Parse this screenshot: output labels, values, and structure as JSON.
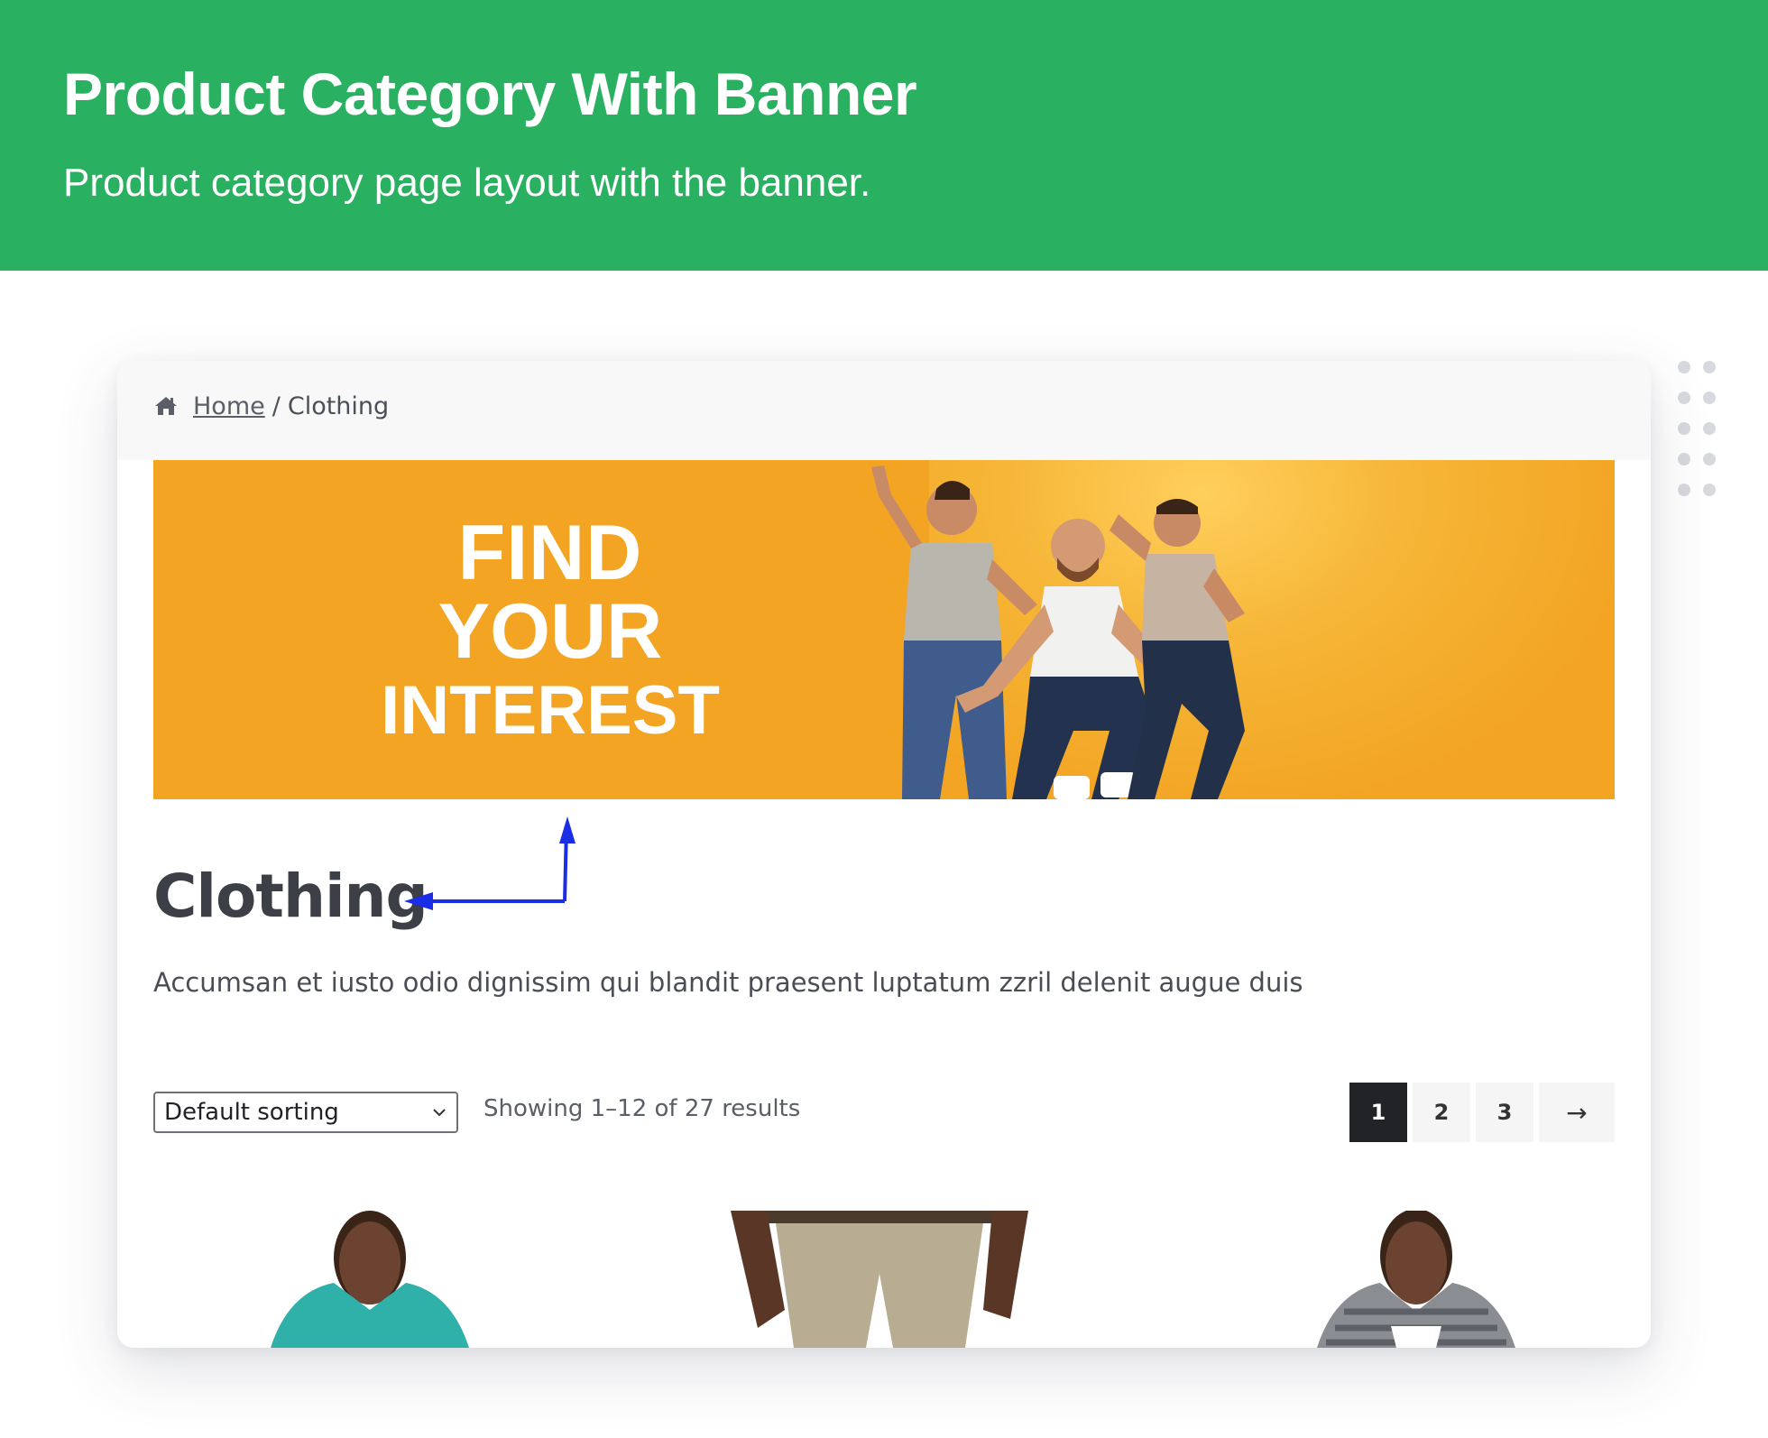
{
  "header": {
    "title": "Product Category With Banner",
    "subtitle": "Product category page layout with the banner."
  },
  "colors": {
    "header_bg": "#2ab061",
    "banner_bg": "#f3a423",
    "annotation_arrow": "#1a2ee6",
    "pager_active": "#222327"
  },
  "breadcrumb": {
    "icon": "home-icon",
    "home_label": "Home",
    "separator": "/",
    "current": "Clothing"
  },
  "banner": {
    "line1": "FIND",
    "line2": "YOUR",
    "line3": "INTEREST"
  },
  "category": {
    "title": "Clothing",
    "description": "Accumsan et iusto odio dignissim qui blandit praesent luptatum zzril delenit augue duis"
  },
  "toolbar": {
    "sort_value": "Default sorting",
    "results_text": "Showing 1–12 of 27 results"
  },
  "pagination": {
    "pages": [
      "1",
      "2",
      "3"
    ],
    "current": "1",
    "next_label": "→"
  }
}
